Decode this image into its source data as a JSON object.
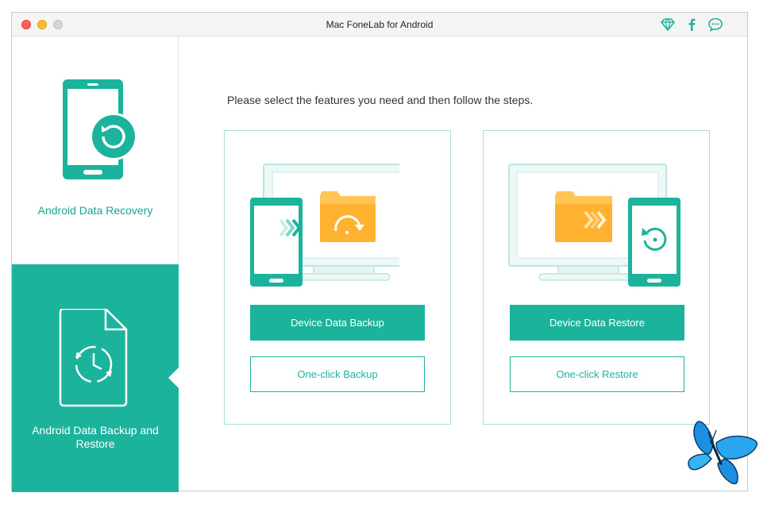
{
  "window": {
    "title": "Mac FoneLab for Android"
  },
  "titlebar_icons": [
    "diamond-icon",
    "facebook-icon",
    "chat-icon"
  ],
  "sidebar": {
    "items": [
      {
        "label": "Android Data Recovery",
        "selected": false
      },
      {
        "label": "Android Data Backup and Restore",
        "selected": true
      }
    ]
  },
  "main": {
    "instruction": "Please select the features you need and then follow the steps.",
    "backup_card": {
      "primary_label": "Device Data Backup",
      "secondary_label": "One-click Backup"
    },
    "restore_card": {
      "primary_label": "Device Data Restore",
      "secondary_label": "One-click Restore"
    }
  },
  "colors": {
    "accent": "#1cb39d",
    "folder": "#ffb12f",
    "card_border": "#a7e0d6"
  }
}
